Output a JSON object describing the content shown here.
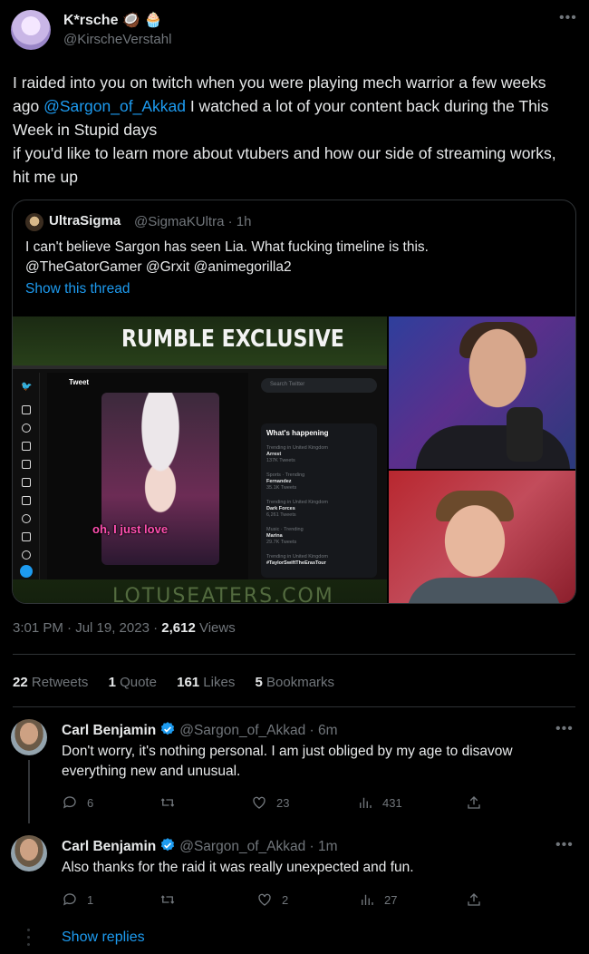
{
  "main_tweet": {
    "display_name": "K*rsche 🥥 🧁",
    "handle": "@KirscheVerstahl",
    "text_parts": {
      "before_mention": "I raided into you on twitch when you were playing mech warrior a few weeks ago ",
      "mention": "@Sargon_of_Akkad",
      "after_mention": " I watched a lot of your content back during the This Week in Stupid days",
      "line2": "if you'd like to learn more about vtubers and how our side of streaming works, hit me up"
    },
    "timestamp": "3:01 PM · Jul 19, 2023 · ",
    "views_count": "2,612",
    "views_label": " Views"
  },
  "quote": {
    "display_name": "UltraSigma",
    "handle": "@SigmaKUltra · 1h",
    "line1": "I can't believe Sargon has seen Lia. What fucking timeline is this.",
    "line2": "@TheGatorGamer @Grxit @animegorilla2",
    "show_thread": "Show this thread",
    "media": {
      "banner": "RUMBLE EXCLUSIVE",
      "column_title": "Tweet",
      "search_placeholder": "Search Twitter",
      "trends_title": "What's happening",
      "trends": [
        {
          "context": "Trending in United Kingdom",
          "name": "Arrest",
          "count": "137K Tweets"
        },
        {
          "context": "Sports · Trending",
          "name": "Fernandez",
          "count": "35.1K Tweets"
        },
        {
          "context": "Trending in United Kingdom",
          "name": "Dark Forces",
          "count": "6,261 Tweets"
        },
        {
          "context": "Music · Trending",
          "name": "Marina",
          "count": "29.7K Tweets"
        },
        {
          "context": "Trending in United Kingdom",
          "name": "#TaylorSwiftTheErasTour",
          "count": ""
        }
      ],
      "caption": "oh, I just love",
      "watermark": "LOTUSEATERS.COM"
    }
  },
  "stats": [
    {
      "count": "22",
      "label": " Retweets"
    },
    {
      "count": "1",
      "label": " Quote"
    },
    {
      "count": "161",
      "label": " Likes"
    },
    {
      "count": "5",
      "label": " Bookmarks"
    }
  ],
  "replies": [
    {
      "display_name": "Carl Benjamin",
      "handle": "@Sargon_of_Akkad · 6m",
      "text": "Don't worry, it's nothing personal. I am just obliged by my age to disavow everything new and unusual.",
      "reply_count": "6",
      "retweet_count": "",
      "like_count": "23",
      "view_count": "431"
    },
    {
      "display_name": "Carl Benjamin",
      "handle": "@Sargon_of_Akkad · 1m",
      "text": "Also thanks for the raid it was really unexpected and fun.",
      "reply_count": "1",
      "retweet_count": "",
      "like_count": "2",
      "view_count": "27"
    }
  ],
  "show_replies": "Show replies",
  "colors": {
    "background": "#000000",
    "text": "#e7e9ea",
    "muted": "#71767b",
    "accent": "#1d9bf0",
    "divider": "#2f3336"
  }
}
